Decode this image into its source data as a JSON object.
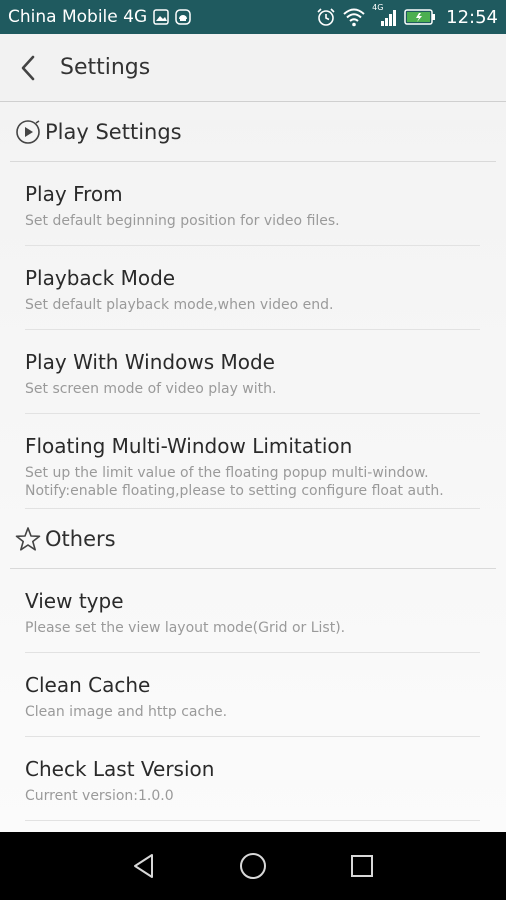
{
  "status_bar": {
    "carrier": "China Mobile 4G",
    "network_label": "4G",
    "time": "12:54"
  },
  "app_bar": {
    "title": "Settings"
  },
  "sections": [
    {
      "title": "Play Settings",
      "items": [
        {
          "title": "Play From",
          "summary": "Set default beginning position for video files."
        },
        {
          "title": "Playback Mode",
          "summary": "Set default playback mode,when video end."
        },
        {
          "title": "Play With Windows Mode",
          "summary": "Set screen mode of video play with."
        },
        {
          "title": "Floating Multi-Window Limitation",
          "summary": "Set up the limit value of the floating popup multi-window.\n Notify:enable floating,please to setting configure float auth."
        }
      ]
    },
    {
      "title": "Others",
      "items": [
        {
          "title": "View type",
          "summary": "Please set the view layout mode(Grid or List)."
        },
        {
          "title": "Clean Cache",
          "summary": "Clean image and http cache."
        },
        {
          "title": "Check Last Version",
          "summary": "Current version:1.0.0"
        }
      ]
    }
  ],
  "colors": {
    "status_bar_bg": "#1f5a5f",
    "nav_bar_bg": "#000000",
    "battery_fill": "#4caf50"
  }
}
